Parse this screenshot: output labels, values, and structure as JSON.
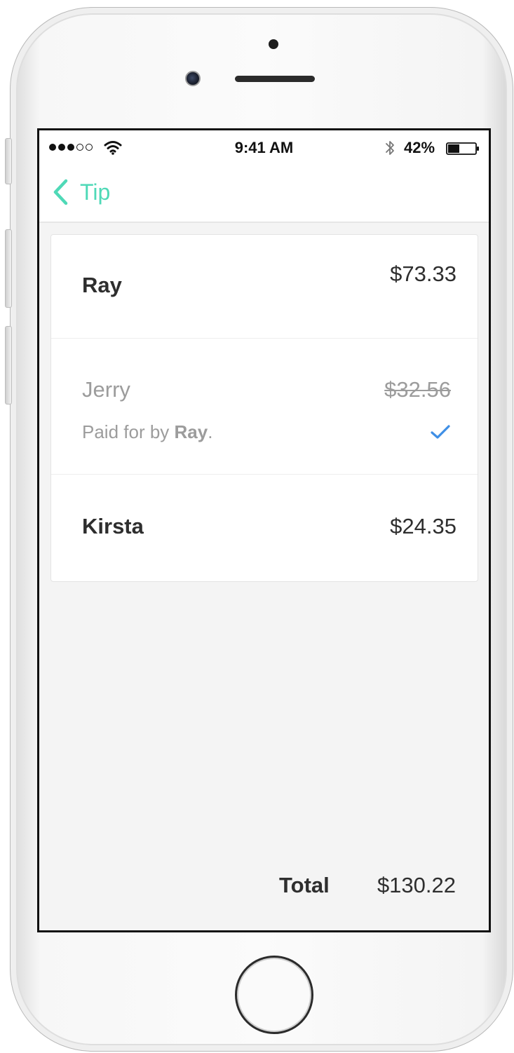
{
  "status_bar": {
    "time": "9:41 AM",
    "battery": "42%",
    "battery_level": 0.42,
    "signal_dots": [
      true,
      true,
      true,
      false,
      false
    ]
  },
  "nav": {
    "back_label": "Tip",
    "accent_color": "#4fd9b7"
  },
  "people": [
    {
      "name": "Ray",
      "amount": "$73.33"
    },
    {
      "name": "Jerry",
      "amount": "$32.56",
      "note_prefix": "Paid for by ",
      "note_payer": "Ray",
      "note_suffix": ".",
      "paid": true
    },
    {
      "name": "Kirsta",
      "amount": "$24.35"
    }
  ],
  "total": {
    "label": "Total",
    "value": "$130.22"
  },
  "colors": {
    "check": "#3f8fe6",
    "muted_text": "#9c9c9c"
  }
}
